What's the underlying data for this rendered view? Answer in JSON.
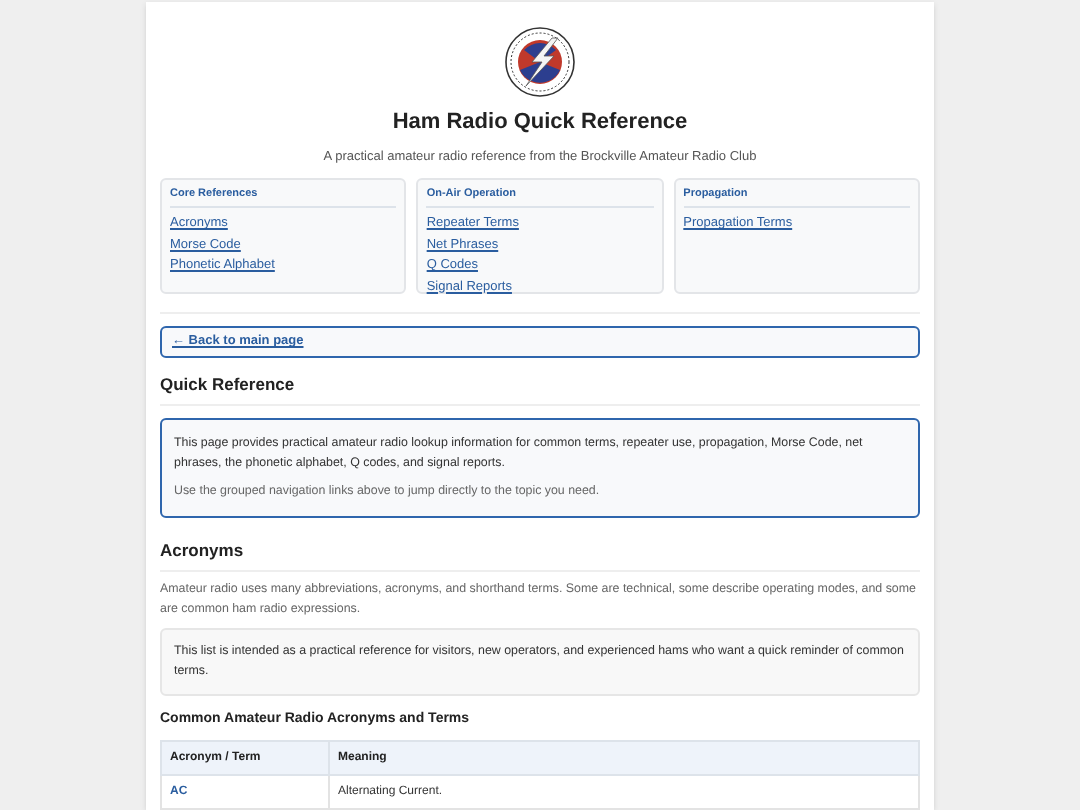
{
  "header": {
    "title": "Ham Radio Quick Reference",
    "subtitle": "A practical amateur radio reference from the Brockville Amateur Radio Club"
  },
  "nav_groups": [
    {
      "heading": "Core References",
      "links": [
        "Acronyms",
        "Morse Code",
        "Phonetic Alphabet"
      ]
    },
    {
      "heading": "On-Air Operation",
      "links": [
        "Repeater Terms",
        "Net Phrases",
        "Q Codes",
        "Signal Reports"
      ]
    },
    {
      "heading": "Propagation",
      "links": [
        "Propagation Terms"
      ]
    }
  ],
  "back_link": "← Back to main page",
  "quick_reference": {
    "heading": "Quick Reference",
    "paragraphs": [
      "This page provides practical amateur radio lookup information for common terms, repeater use, propagation, Morse Code, net phrases, the phonetic alphabet, Q codes, and signal reports.",
      "Use the grouped navigation links above to jump directly to the topic you need."
    ]
  },
  "acronyms": {
    "heading": "Acronyms",
    "intro": "Amateur radio uses many abbreviations, acronyms, and shorthand terms. Some are technical, some describe operating modes, and some are common ham radio expressions.",
    "note": "This list is intended as a practical reference for visitors, new operators, and experienced hams who want a quick reminder of common terms.",
    "table_title": "Common Amateur Radio Acronyms and Terms",
    "table": {
      "columns": [
        "Acronym / Term",
        "Meaning"
      ],
      "rows": [
        [
          "AC",
          "Alternating Current."
        ]
      ]
    }
  }
}
